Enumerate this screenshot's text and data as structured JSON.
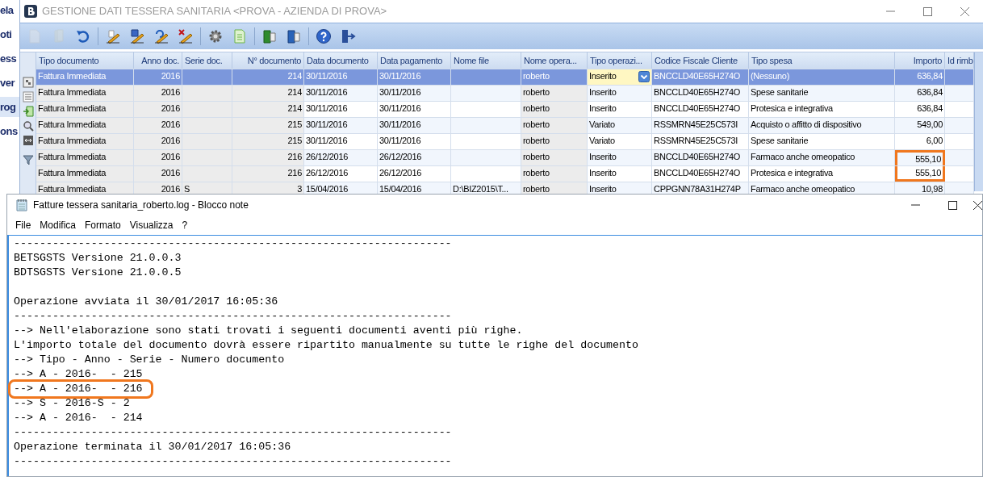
{
  "background_app": {
    "items": [
      {
        "label": "ela",
        "selected": false
      },
      {
        "label": "oti",
        "selected": false
      },
      {
        "label": "ess",
        "selected": false
      },
      {
        "label": "ver",
        "selected": false
      },
      {
        "label": "rog",
        "selected": true
      },
      {
        "label": "ons",
        "selected": false
      }
    ]
  },
  "main_window": {
    "title": "GESTIONE DATI TESSERA SANITARIA <PROVA - AZIENDA DI PROVA>",
    "toolbar": [
      {
        "kind": "new",
        "disabled": true
      },
      {
        "kind": "copy",
        "disabled": true
      },
      {
        "kind": "undo",
        "disabled": false
      },
      {
        "kind": "edit",
        "disabled": false
      },
      {
        "kind": "save_edit",
        "disabled": false
      },
      {
        "kind": "undo_edit",
        "disabled": false
      },
      {
        "kind": "delete_edit",
        "disabled": false
      },
      {
        "kind": "settings",
        "disabled": false
      },
      {
        "kind": "sheet",
        "disabled": false
      },
      {
        "kind": "export",
        "disabled": false
      },
      {
        "kind": "import",
        "disabled": false
      },
      {
        "kind": "help",
        "disabled": false
      },
      {
        "kind": "exit",
        "disabled": false
      }
    ],
    "table": {
      "columns": [
        "Tipo documento",
        "Anno doc.",
        "Serie doc.",
        "N° documento",
        "Data documento",
        "Data pagamento",
        "Nome file",
        "Nome opera...",
        "Tipo operazi...",
        "Codice Fiscale Cliente",
        "Tipo spesa",
        "Importo",
        "Id rimb"
      ],
      "rows": [
        {
          "selected": true,
          "editing": true,
          "boxed": false,
          "cells": [
            "Fattura Immediata",
            "2016",
            null,
            "214",
            "30/11/2016",
            "30/11/2016",
            null,
            "roberto",
            "Inserito",
            "BNCCLD40E65H274O",
            "(Nessuno)",
            "636,84",
            null
          ]
        },
        {
          "selected": false,
          "editing": false,
          "boxed": false,
          "cells": [
            "Fattura Immediata",
            "2016",
            null,
            "214",
            "30/11/2016",
            "30/11/2016",
            null,
            "roberto",
            "Inserito",
            "BNCCLD40E65H274O",
            "Spese sanitarie",
            "636,84",
            null
          ]
        },
        {
          "selected": false,
          "editing": false,
          "boxed": false,
          "cells": [
            "Fattura Immediata",
            "2016",
            null,
            "214",
            "30/11/2016",
            "30/11/2016",
            null,
            "roberto",
            "Inserito",
            "BNCCLD40E65H274O",
            "Protesica e integrativa",
            "636,84",
            null
          ]
        },
        {
          "selected": false,
          "editing": false,
          "boxed": false,
          "cells": [
            "Fattura Immediata",
            "2016",
            null,
            "215",
            "30/11/2016",
            "30/11/2016",
            null,
            "roberto",
            "Variato",
            "RSSMRN45E25C573I",
            "Acquisto o affitto di dispositivo",
            "549,00",
            null
          ]
        },
        {
          "selected": false,
          "editing": false,
          "boxed": false,
          "cells": [
            "Fattura Immediata",
            "2016",
            null,
            "215",
            "30/11/2016",
            "30/11/2016",
            null,
            "roberto",
            "Variato",
            "RSSMRN45E25C573I",
            "Spese sanitarie",
            "6,00",
            null
          ]
        },
        {
          "selected": false,
          "editing": false,
          "boxed": true,
          "cells": [
            "Fattura Immediata",
            "2016",
            null,
            "216",
            "26/12/2016",
            "26/12/2016",
            null,
            "roberto",
            "Inserito",
            "BNCCLD40E65H274O",
            "Farmaco anche omeopatico",
            "555,10",
            null
          ]
        },
        {
          "selected": false,
          "editing": false,
          "boxed": true,
          "cells": [
            "Fattura Immediata",
            "2016",
            null,
            "216",
            "26/12/2016",
            "26/12/2016",
            null,
            "roberto",
            "Inserito",
            "BNCCLD40E65H274O",
            "Protesica e integrativa",
            "555,10",
            null
          ]
        },
        {
          "selected": false,
          "editing": false,
          "boxed": false,
          "cells": [
            "Fattura Immediata",
            "2016",
            "S",
            "3",
            "15/04/2016",
            "15/04/2016",
            "D:\\BIZ2015\\T...",
            "roberto",
            "Inserito",
            "CPPGNN78A31H274P",
            "Farmaco anche omeopatico",
            "10,98",
            null
          ]
        }
      ]
    }
  },
  "notepad": {
    "title": "Fatture tessera sanitaria_roberto.log - Blocco note",
    "menu": [
      "File",
      "Modifica",
      "Formato",
      "Visualizza",
      "?"
    ],
    "lines": [
      {
        "kind": "text",
        "text": "--------------------------------------------------------------------",
        "boxed": false
      },
      {
        "kind": "text",
        "text": "BETSGSTS Versione 21.0.0.3",
        "boxed": false
      },
      {
        "kind": "text",
        "text": "BDTSGSTS Versione 21.0.0.5",
        "boxed": false
      },
      {
        "kind": "blank"
      },
      {
        "kind": "text",
        "text": "Operazione avviata il 30/01/2017 16:05:36",
        "boxed": false
      },
      {
        "kind": "text",
        "text": "--------------------------------------------------------------------",
        "boxed": false
      },
      {
        "kind": "text",
        "text": "--> Nell'elaborazione sono stati trovati i seguenti documenti aventi più righe.",
        "boxed": false
      },
      {
        "kind": "text",
        "text": "L'importo totale del documento dovrà essere ripartito manualmente su tutte le righe del documento",
        "boxed": false
      },
      {
        "kind": "text",
        "text": "--> Tipo - Anno - Serie - Numero documento",
        "boxed": false
      },
      {
        "kind": "text",
        "text": "--> A - 2016-  - 215",
        "boxed": false
      },
      {
        "kind": "text",
        "text": "--> A - 2016-  - 216",
        "boxed": true
      },
      {
        "kind": "text",
        "text": "--> S - 2016-S - 2",
        "boxed": false
      },
      {
        "kind": "text",
        "text": "--> A - 2016-  - 214",
        "boxed": false
      },
      {
        "kind": "text",
        "text": "--------------------------------------------------------------------",
        "boxed": false
      },
      {
        "kind": "text",
        "text": "Operazione terminata il 30/01/2017 16:05:36",
        "boxed": false
      },
      {
        "kind": "text",
        "text": "--------------------------------------------------------------------",
        "boxed": false
      }
    ]
  }
}
